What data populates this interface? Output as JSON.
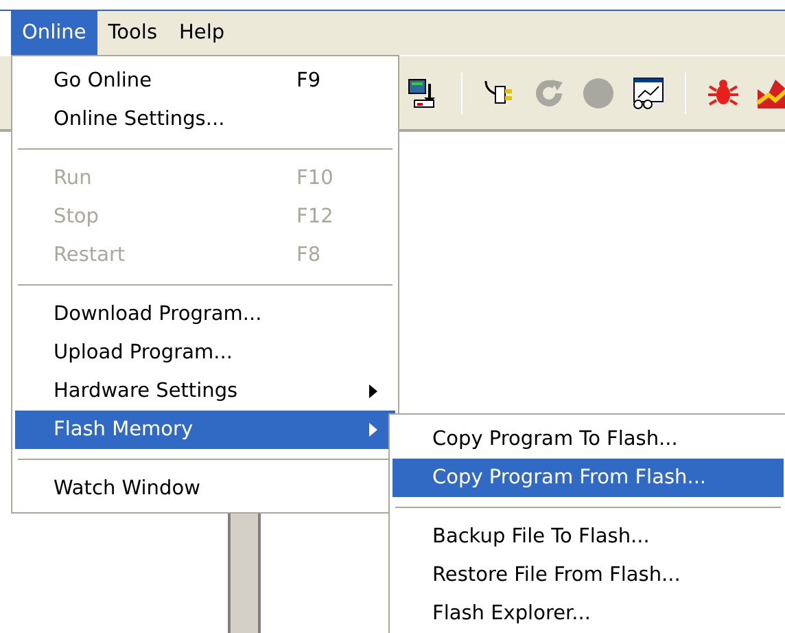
{
  "menubar": [
    {
      "label": "Online",
      "selected": true
    },
    {
      "label": "Tools",
      "selected": false
    },
    {
      "label": "Help",
      "selected": false
    }
  ],
  "menu": [
    {
      "kind": "item",
      "label": "Go Online",
      "shortcut": "F9",
      "disabled": false,
      "selected": false,
      "submenu": false
    },
    {
      "kind": "item",
      "label": "Online Settings...",
      "disabled": false,
      "selected": false,
      "submenu": false
    },
    {
      "kind": "separator"
    },
    {
      "kind": "item",
      "label": "Run",
      "shortcut": "F10",
      "disabled": true,
      "selected": false,
      "submenu": false
    },
    {
      "kind": "item",
      "label": "Stop",
      "shortcut": "F12",
      "disabled": true,
      "selected": false,
      "submenu": false
    },
    {
      "kind": "item",
      "label": "Restart",
      "shortcut": "F8",
      "disabled": true,
      "selected": false,
      "submenu": false
    },
    {
      "kind": "separator"
    },
    {
      "kind": "item",
      "label": "Download Program...",
      "disabled": false,
      "selected": false,
      "submenu": false
    },
    {
      "kind": "item",
      "label": "Upload Program...",
      "disabled": false,
      "selected": false,
      "submenu": false
    },
    {
      "kind": "item",
      "label": "Hardware Settings",
      "disabled": false,
      "selected": false,
      "submenu": true
    },
    {
      "kind": "item",
      "label": "Flash Memory",
      "disabled": false,
      "selected": true,
      "submenu": true
    },
    {
      "kind": "separator"
    },
    {
      "kind": "item",
      "label": "Watch Window",
      "disabled": false,
      "selected": false,
      "submenu": false
    }
  ],
  "submenu": [
    {
      "kind": "item",
      "label": "Copy Program To Flash...",
      "selected": false
    },
    {
      "kind": "item",
      "label": "Copy Program From Flash...",
      "selected": true
    },
    {
      "kind": "separator"
    },
    {
      "kind": "item",
      "label": "Backup File To Flash...",
      "selected": false
    },
    {
      "kind": "item",
      "label": "Restore File From Flash...",
      "selected": false
    },
    {
      "kind": "item",
      "label": "Flash Explorer...",
      "selected": false
    }
  ]
}
